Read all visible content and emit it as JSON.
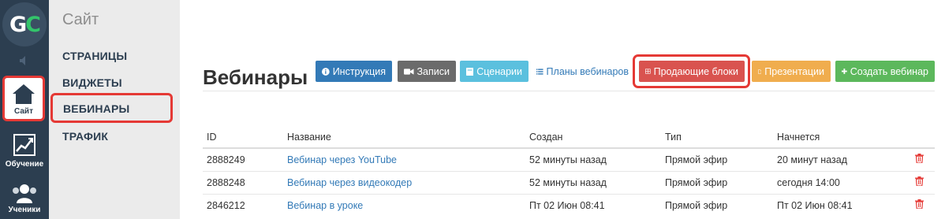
{
  "logo": {
    "g": "G",
    "c": "C"
  },
  "rail": {
    "site_label": "Сайт",
    "learning_label": "Обучение",
    "students_label": "Ученики"
  },
  "submenu": {
    "title": "Сайт",
    "items": [
      "СТРАНИЦЫ",
      "ВИДЖЕТЫ",
      "ВЕБИНАРЫ",
      "ТРАФИК"
    ]
  },
  "page": {
    "title": "Вебинары"
  },
  "toolbar": {
    "instructions": "Инструкция",
    "records": "Записи",
    "scenarios": "Сценарии",
    "plans": "Планы вебинаров",
    "selling_blocks": "Продающие блоки",
    "presentations": "Презентации",
    "create": "Создать вебинар"
  },
  "table": {
    "headers": [
      "ID",
      "Название",
      "Создан",
      "Тип",
      "Начнется"
    ],
    "rows": [
      {
        "id": "2888249",
        "name": "Вебинар через YouTube",
        "created": "52 минуты назад",
        "type": "Прямой эфир",
        "start": "20 минут назад"
      },
      {
        "id": "2888248",
        "name": "Вебинар через видеокодер",
        "created": "52 минуты назад",
        "type": "Прямой эфир",
        "start": "сегодня 14:00"
      },
      {
        "id": "2846212",
        "name": "Вебинар в уроке",
        "created": "Пт 02 Июн 08:41",
        "type": "Прямой эфир",
        "start": "Пт 02 Июн 08:41"
      }
    ]
  },
  "colors": {
    "accent": "#337ab7",
    "danger": "#d9534f",
    "highlight": "#e53935",
    "rail": "#2c3e50"
  }
}
